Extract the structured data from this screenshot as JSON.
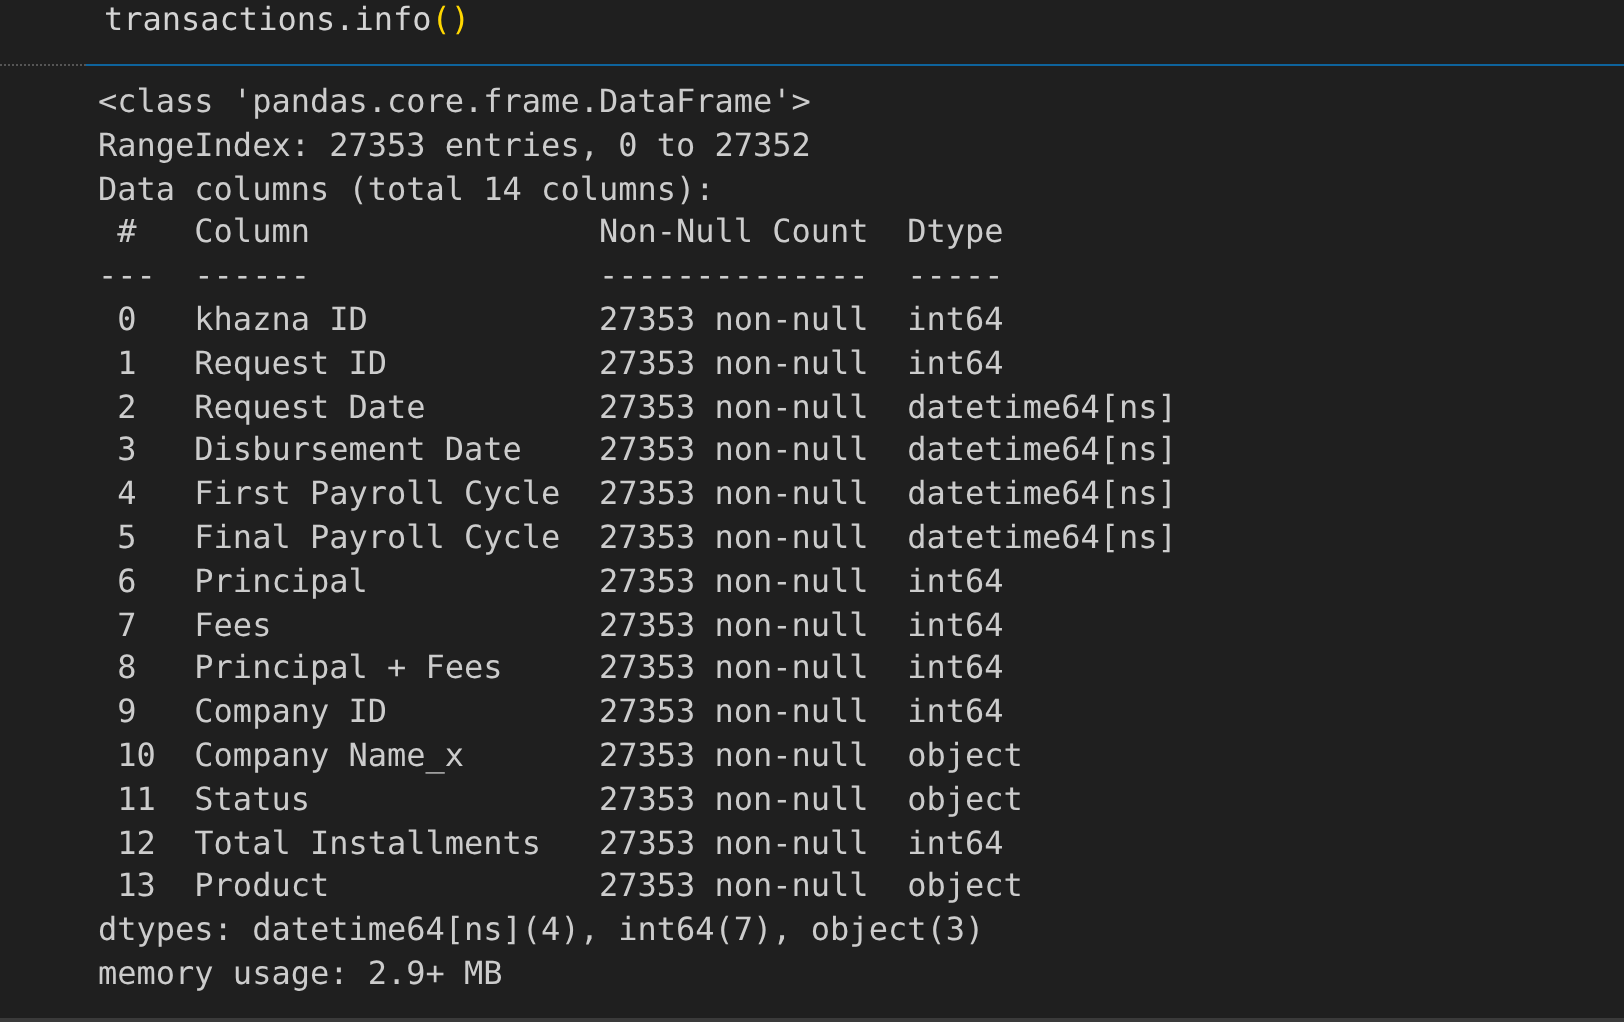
{
  "code_cell": {
    "tokens": [
      {
        "kind": "name",
        "text": "transactions.info"
      },
      {
        "kind": "bracket",
        "text": "()"
      }
    ]
  },
  "output": {
    "lines": [
      "<class 'pandas.core.frame.DataFrame'>",
      "RangeIndex: 27353 entries, 0 to 27352",
      "Data columns (total 14 columns):",
      " #   Column               Non-Null Count  Dtype         ",
      "---  ------               --------------  -----         ",
      " 0   khazna ID            27353 non-null  int64         ",
      " 1   Request ID           27353 non-null  int64         ",
      " 2   Request Date         27353 non-null  datetime64[ns]",
      " 3   Disbursement Date    27353 non-null  datetime64[ns]",
      " 4   First Payroll Cycle  27353 non-null  datetime64[ns]",
      " 5   Final Payroll Cycle  27353 non-null  datetime64[ns]",
      " 6   Principal            27353 non-null  int64         ",
      " 7   Fees                 27353 non-null  int64         ",
      " 8   Principal + Fees     27353 non-null  int64         ",
      " 9   Company ID           27353 non-null  int64         ",
      " 10  Company Name_x       27353 non-null  object        ",
      " 11  Status               27353 non-null  object        ",
      " 12  Total Installments   27353 non-null  int64         ",
      " 13  Product              27353 non-null  object        ",
      "dtypes: datetime64[ns](4), int64(7), object(3)",
      "memory usage: 2.9+ MB"
    ]
  }
}
